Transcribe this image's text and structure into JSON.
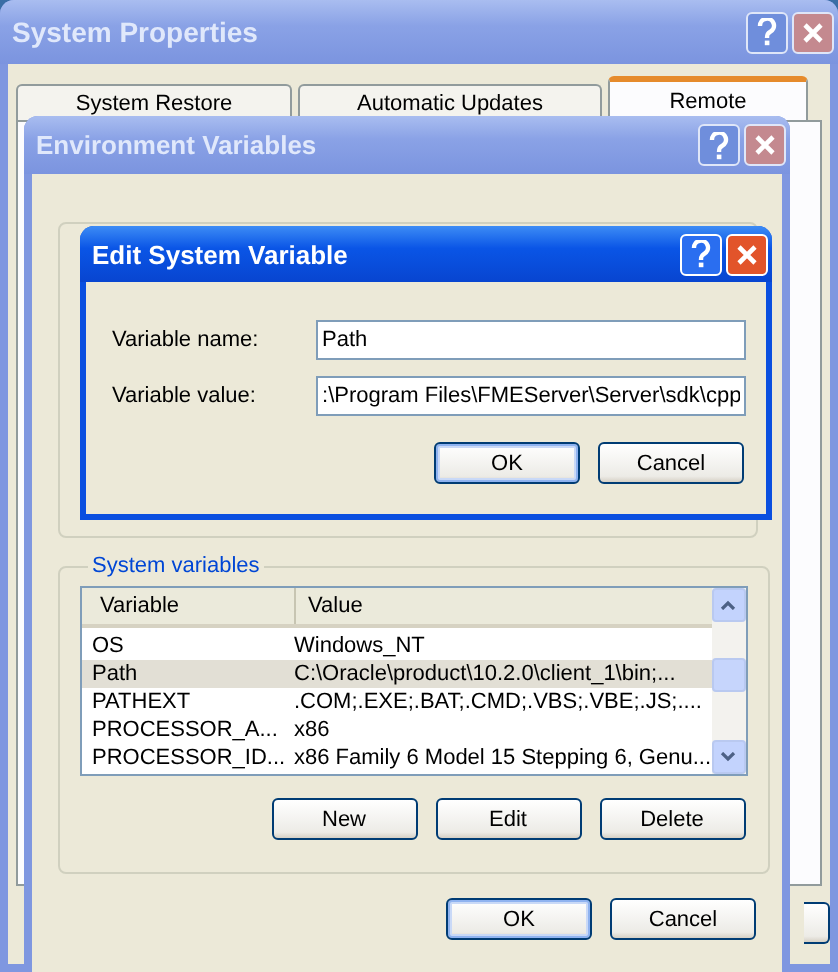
{
  "system_properties": {
    "title": "System Properties",
    "active": false,
    "tabs": [
      {
        "label": "System Restore",
        "selected": false
      },
      {
        "label": "Automatic Updates",
        "selected": false
      },
      {
        "label": "Remote",
        "selected": true
      }
    ]
  },
  "environment_variables": {
    "title": "Environment Variables",
    "active": false,
    "system_group_label": "System variables",
    "columns": [
      "Variable",
      "Value"
    ],
    "rows": [
      {
        "variable": "OS",
        "value": "Windows_NT",
        "selected": false
      },
      {
        "variable": "Path",
        "value": "C:\\Oracle\\product\\10.2.0\\client_1\\bin;...",
        "selected": true
      },
      {
        "variable": "PATHEXT",
        "value": ".COM;.EXE;.BAT;.CMD;.VBS;.VBE;.JS;....",
        "selected": false
      },
      {
        "variable": "PROCESSOR_A...",
        "value": "x86",
        "selected": false
      },
      {
        "variable": "PROCESSOR_ID...",
        "value": "x86 Family 6 Model 15 Stepping 6, Genu...",
        "selected": false
      }
    ],
    "buttons": [
      "New",
      "Edit",
      "Delete"
    ],
    "footer_buttons": [
      "OK",
      "Cancel"
    ]
  },
  "edit_dialog": {
    "title": "Edit System Variable",
    "active": true,
    "fields": [
      {
        "label": "Variable name:",
        "value": "Path"
      },
      {
        "label": "Variable value:",
        "value": ":\\Program Files\\FMEServer\\Server\\sdk\\cpp"
      }
    ],
    "buttons": [
      "OK",
      "Cancel"
    ]
  }
}
